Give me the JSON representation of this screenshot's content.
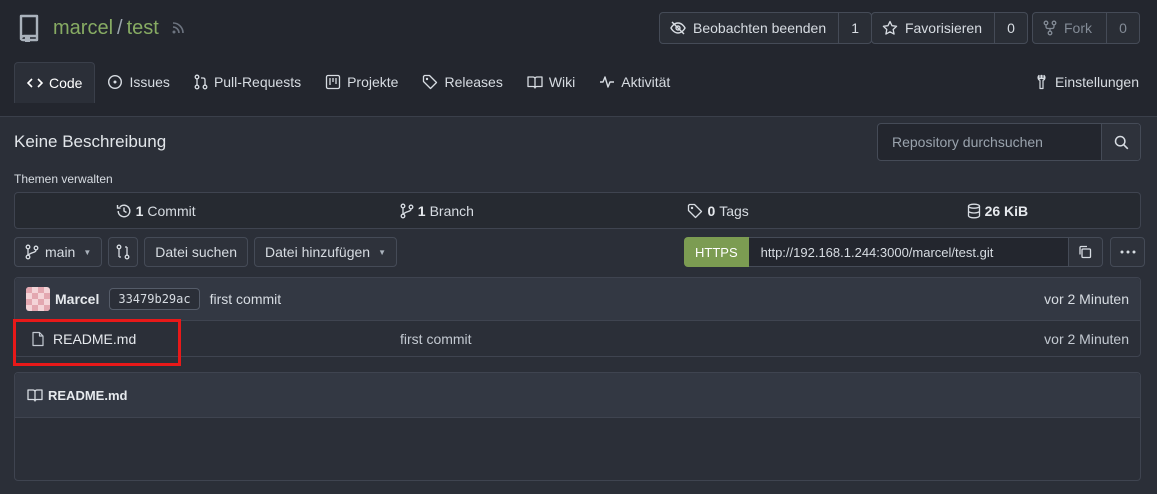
{
  "repo": {
    "owner": "marcel",
    "separator": "/",
    "name": "test"
  },
  "actions": {
    "watch": {
      "label": "Beobachten beenden",
      "count": "1"
    },
    "star": {
      "label": "Favorisieren",
      "count": "0"
    },
    "fork": {
      "label": "Fork",
      "count": "0"
    }
  },
  "tabs": [
    {
      "label": "Code",
      "icon": "code-icon",
      "active": true
    },
    {
      "label": "Issues",
      "icon": "issue-icon"
    },
    {
      "label": "Pull-Requests",
      "icon": "pull-request-icon"
    },
    {
      "label": "Projekte",
      "icon": "project-icon"
    },
    {
      "label": "Releases",
      "icon": "tag-icon"
    },
    {
      "label": "Wiki",
      "icon": "book-icon"
    },
    {
      "label": "Aktivität",
      "icon": "pulse-icon"
    }
  ],
  "settings_tab": {
    "label": "Einstellungen",
    "icon": "tools-icon"
  },
  "description": "Keine Beschreibung",
  "topics_link": "Themen verwalten",
  "search": {
    "placeholder": "Repository durchsuchen"
  },
  "stats": {
    "commits": {
      "value": "1",
      "label": "Commit"
    },
    "branches": {
      "value": "1",
      "label": "Branch"
    },
    "tags": {
      "value": "0",
      "label": "Tags"
    },
    "size": {
      "value": "26 KiB"
    }
  },
  "branch_bar": {
    "branch": "main",
    "find_file": "Datei suchen",
    "add_file": "Datei hinzufügen"
  },
  "clone": {
    "protocol": "HTTPS",
    "url": "http://192.168.1.244:3000/marcel/test.git"
  },
  "latest_commit": {
    "author": "Marcel",
    "sha": "33479b29ac",
    "message": "first commit",
    "time": "vor 2 Minuten"
  },
  "files": [
    {
      "name": "README.md",
      "message": "first commit",
      "time": "vor 2 Minuten"
    }
  ],
  "readme": {
    "title": "README.md"
  },
  "colors": {
    "accent": "#87ab63",
    "https": "#7c9c52",
    "highlight": "#e81919"
  }
}
